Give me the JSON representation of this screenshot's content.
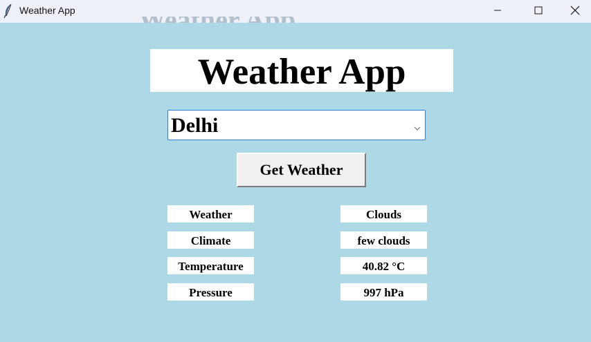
{
  "window": {
    "title": "Weather App"
  },
  "app": {
    "heading": "Weather App",
    "city_selected": "Delhi",
    "button_label": "Get Weather"
  },
  "info": {
    "labels": [
      "Weather",
      "Climate",
      "Temperature",
      "Pressure"
    ],
    "values": [
      "Clouds",
      "few clouds",
      "40.82 °C",
      "997 hPa"
    ]
  },
  "colors": {
    "background": "#add8e6",
    "titlebar": "#eef2f8",
    "select_border": "#2f7fd4"
  },
  "icons": [
    "feather-icon",
    "minimize-icon",
    "maximize-icon",
    "close-icon",
    "chevron-down-icon"
  ]
}
